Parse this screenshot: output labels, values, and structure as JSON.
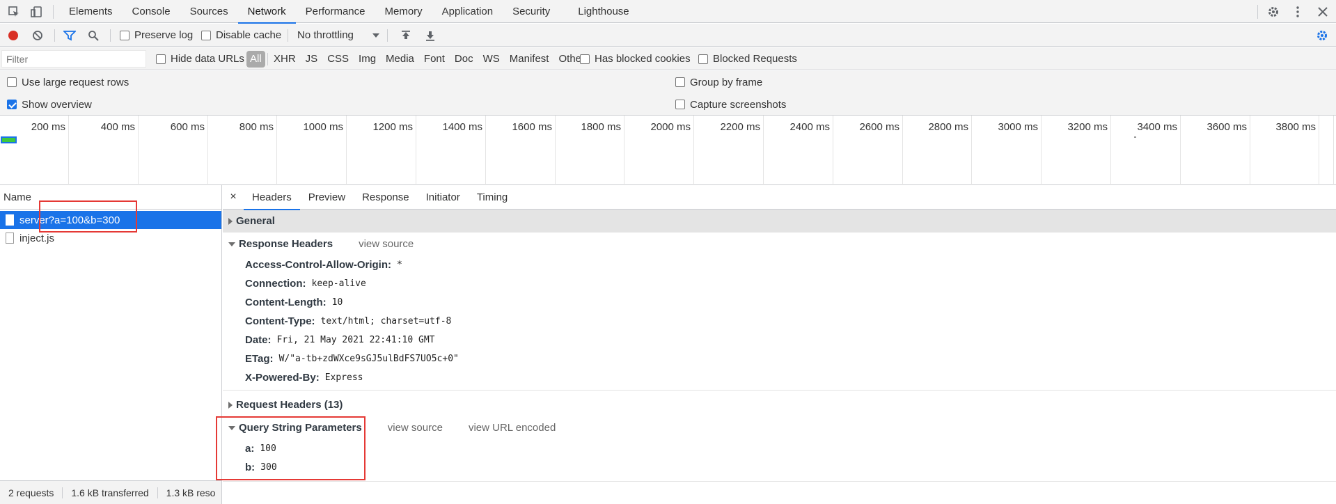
{
  "tabbar": {
    "tabs": [
      "Elements",
      "Console",
      "Sources",
      "Network",
      "Performance",
      "Memory",
      "Application",
      "Security",
      "Lighthouse"
    ],
    "active_tab": "Network"
  },
  "toolbar": {
    "preserve_log": "Preserve log",
    "disable_cache": "Disable cache",
    "throttling": "No throttling"
  },
  "filterbar": {
    "filter_placeholder": "Filter",
    "hide_data_urls": "Hide data URLs",
    "types": [
      "All",
      "XHR",
      "JS",
      "CSS",
      "Img",
      "Media",
      "Font",
      "Doc",
      "WS",
      "Manifest",
      "Other"
    ],
    "active_type": "All",
    "has_blocked_cookies": "Has blocked cookies",
    "blocked_requests": "Blocked Requests"
  },
  "settings": {
    "large_rows": "Use large request rows",
    "show_overview": "Show overview",
    "group_by_frame": "Group by frame",
    "capture_screenshots": "Capture screenshots"
  },
  "overview": {
    "ticks": [
      "200 ms",
      "400 ms",
      "600 ms",
      "800 ms",
      "1000 ms",
      "1200 ms",
      "1400 ms",
      "1600 ms",
      "1800 ms",
      "2000 ms",
      "2200 ms",
      "2400 ms",
      "2600 ms",
      "2800 ms",
      "3000 ms",
      "3200 ms",
      "3400 ms",
      "3600 ms",
      "3800 ms"
    ]
  },
  "requests": {
    "header": "Name",
    "rows": [
      "server?a=100&b=300",
      "inject.js"
    ],
    "selected": "server?a=100&b=300"
  },
  "statusbar": {
    "requests": "2 requests",
    "transferred": "1.6 kB transferred",
    "resources": "1.3 kB reso"
  },
  "details": {
    "close": "×",
    "tabs": [
      "Headers",
      "Preview",
      "Response",
      "Initiator",
      "Timing"
    ],
    "active_tab": "Headers",
    "general": "General",
    "response_headers": {
      "title": "Response Headers",
      "view_source": "view source",
      "rows": [
        {
          "name": "Access-Control-Allow-Origin:",
          "value": "*"
        },
        {
          "name": "Connection:",
          "value": "keep-alive"
        },
        {
          "name": "Content-Length:",
          "value": "10"
        },
        {
          "name": "Content-Type:",
          "value": "text/html; charset=utf-8"
        },
        {
          "name": "Date:",
          "value": "Fri, 21 May 2021 22:41:10 GMT"
        },
        {
          "name": "ETag:",
          "value": "W/\"a-tb+zdWXce9sGJ5ulBdFS7UO5c+0\""
        },
        {
          "name": "X-Powered-By:",
          "value": "Express"
        }
      ]
    },
    "request_headers": "Request Headers (13)",
    "query_params": {
      "title": "Query String Parameters",
      "view_source": "view source",
      "view_url_encoded": "view URL encoded",
      "rows": [
        {
          "name": "a:",
          "value": "100"
        },
        {
          "name": "b:",
          "value": "300"
        }
      ]
    }
  },
  "colors": {
    "accent": "#1a73e8",
    "record": "#d93025",
    "highlight_box": "#e53935"
  }
}
